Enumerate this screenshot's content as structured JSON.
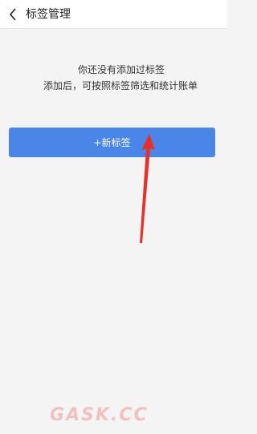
{
  "header": {
    "title": "标签管理"
  },
  "empty_state": {
    "line1": "你还没有添加过标签",
    "line2": "添加后，可按照标签筛选和统计账单"
  },
  "actions": {
    "new_tag_label": "+新标签"
  },
  "watermark": {
    "text": "GASK.CC"
  },
  "colors": {
    "button": "#4a86e8",
    "arrow": "#e8302a"
  }
}
